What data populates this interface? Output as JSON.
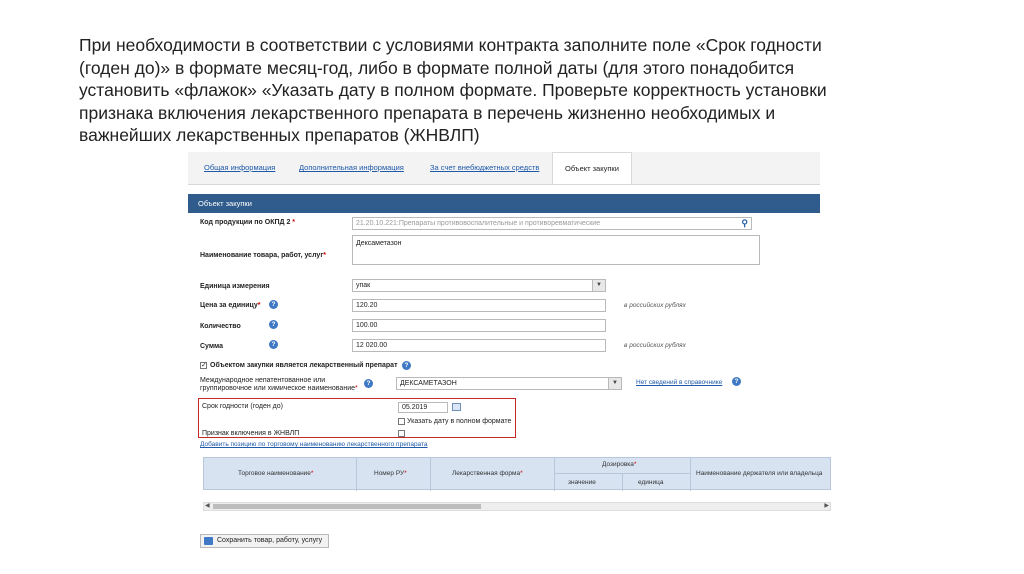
{
  "slide": {
    "lines": [
      "При необходимости в соответствии с условиями контракта заполните поле «Срок годности",
      "(годен до)» в формате месяц-год, либо в формате полной даты (для этого понадобится",
      "установить «флажок» «Указать дату в полном формате. Проверьте корректность установки",
      "признака включения лекарственного препарата в перечень жизненно необходимых и",
      "важнейших лекарственных препаратов (ЖНВЛП)"
    ]
  },
  "tabs": [
    "Общая информация",
    "Дополнительная информация",
    "За счет внебюджетных средств",
    "Объект закупки"
  ],
  "panel_title": "Объект закупки",
  "form": {
    "okpd_label": "Код продукции по ОКПД 2",
    "okpd_value": "21.20.10.221:Препараты противовоспалительные и противоревматические",
    "name_label": "Наименование товара, работ, услуг",
    "name_value": "Дексаметазон",
    "unit_label": "Единица измерения",
    "unit_value": "упак",
    "price_label": "Цена за единицу",
    "price_value": "120.20",
    "price_hint": "в российских рублях",
    "qty_label": "Количество",
    "qty_value": "100.00",
    "sum_label": "Сумма",
    "sum_value": "12 020.00",
    "sum_hint": "в российских рублях",
    "drug_check_label": "Объектом закупки является лекарственный препарат",
    "inn_label_1": "Международное непатентованное или",
    "inn_label_2": "группировочное или химическое наименование",
    "inn_value": "ДЕКСАМЕТАЗОН",
    "inn_link": "Нет сведений в справочнике",
    "expiry_label": "Срок годности (годен до)",
    "expiry_value": "05.2019",
    "full_date_label": "Указать дату в полном формате",
    "zhnvlp_label": "Признак включения в ЖНВЛП",
    "add_link": "Добавить позицию по торговому наименованию лекарственного препарата"
  },
  "table": {
    "col_trade": "Торговое наименование",
    "col_ru": "Номер РУ",
    "col_form": "Лекарственная форма",
    "col_dosage": "Дозировка",
    "col_value": "значение",
    "col_unit": "единица",
    "col_holder": "Наименование держателя или владельца"
  },
  "save_button": "Сохранить товар, работу, услугу",
  "colors": {
    "panel_header": "#2f5c8c",
    "link": "#1e5aa8",
    "highlight_box": "#c62828",
    "table_header": "#d7e3f1"
  }
}
